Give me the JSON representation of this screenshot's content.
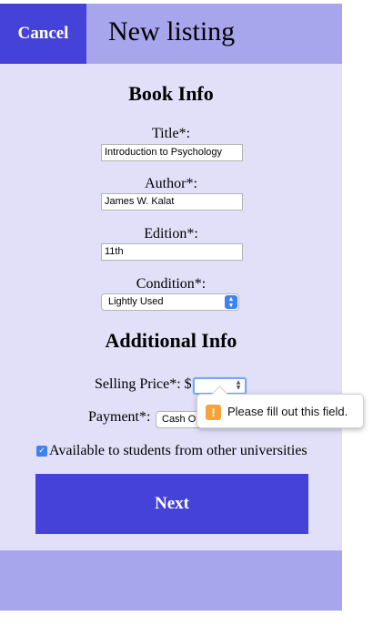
{
  "header": {
    "cancel_label": "Cancel",
    "title": "New listing"
  },
  "book_info": {
    "heading": "Book Info",
    "title_label": "Title*:",
    "title_value": "Introduction to Psychology",
    "author_label": "Author*:",
    "author_value": "James W. Kalat",
    "edition_label": "Edition*:",
    "edition_value": "11th",
    "condition_label": "Condition*:",
    "condition_value": "Lightly Used"
  },
  "additional_info": {
    "heading": "Additional Info",
    "price_label": "Selling Price*: $",
    "price_value": "",
    "payment_label": "Payment*:",
    "payment_value": "Cash Only",
    "availability_label": "Available to students from other universities",
    "availability_checked": true
  },
  "validation": {
    "message": "Please fill out this field.",
    "icon": "warning-icon"
  },
  "actions": {
    "next_label": "Next"
  },
  "colors": {
    "primary": "#4442d8",
    "header_bg": "#a7a5ec",
    "page_bg": "#e1e0f8",
    "warning": "#f6a33a",
    "focus": "#3b83f0"
  }
}
